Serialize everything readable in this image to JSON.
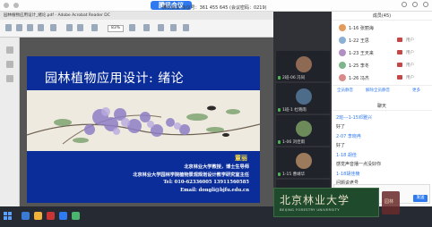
{
  "topbar": {
    "brand": "腾讯会议",
    "meeting_info": "腾讯会议  会议号：361 455 645   (会议密码：0219)"
  },
  "app_window": {
    "title": "园林植物应用设计_绪论.pdf - Adobe Acrobat Reader DC",
    "zoom": "83%"
  },
  "slide": {
    "title": "园林植物应用设计: 绪论",
    "teacher": "董丽",
    "line1": "北京林业大学教授，博士生导师",
    "line2": "北京林业大学园林学院植物景观规划设计教学研究室主任",
    "tel": "Tel: 010-62336005  13911560585",
    "email": "Email: dongli@bjfu.edu.cn"
  },
  "video_tiles": [
    {
      "name": "2班-06 冯同"
    },
    {
      "name": "1班-1 杜晓雨"
    },
    {
      "name": "1-06 刘佳雨"
    },
    {
      "name": "1-15 曹靖华"
    },
    {
      "name": "1-06 赵佳佳"
    }
  ],
  "members": {
    "title": "成员(45)",
    "list": [
      {
        "name": "1-16 张丽海",
        "role": ""
      },
      {
        "name": "1-22 王思",
        "role": "用户"
      },
      {
        "name": "1-23 王天来",
        "role": "用户"
      },
      {
        "name": "1-25 李冬",
        "role": "用户"
      },
      {
        "name": "1-26 冯杰",
        "role": "用户"
      }
    ],
    "actions": [
      "全员静音",
      "解除全员静音",
      "更多"
    ]
  },
  "chat": {
    "title": "聊天",
    "messages": [
      {
        "text": "2班---1-15邓雅兴",
        "type": "name"
      },
      {
        "text": "好了",
        "type": "msg"
      },
      {
        "text": "2-07 李晓冉",
        "type": "name"
      },
      {
        "text": "好了",
        "type": "msg"
      },
      {
        "text": "1-18 胡佳",
        "type": "name"
      },
      {
        "text": "感觉声音播一点没好你",
        "type": "msg"
      },
      {
        "text": "1-18胡佳楠",
        "type": "name"
      },
      {
        "text": "问题说老号",
        "type": "msg"
      }
    ],
    "send_label": "发送"
  },
  "logo": {
    "text": "北京林业大学",
    "sub": "BEIJING FORESTRY UNIVERSITY",
    "badge": "园林"
  }
}
